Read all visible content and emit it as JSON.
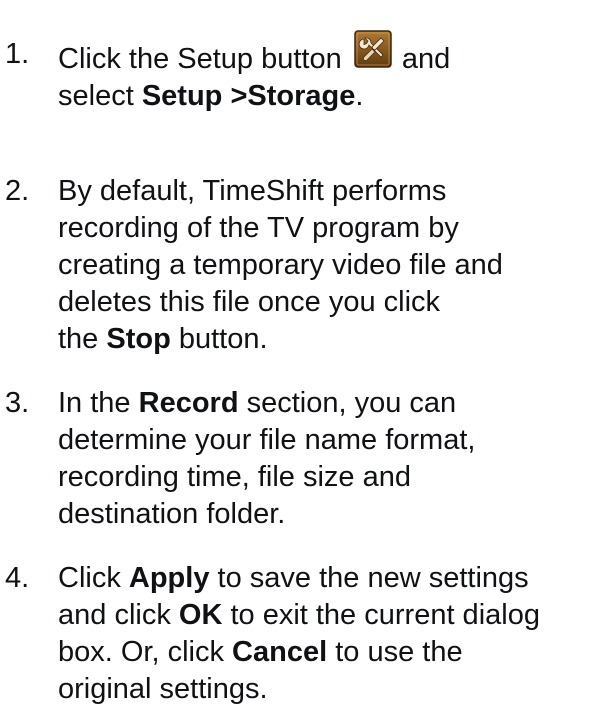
{
  "steps": [
    {
      "number": "1.",
      "line1_pre": "Click the Setup button",
      "line1_post": "and",
      "line2_pre": "select ",
      "line2_bold": "Setup >Storage",
      "line2_post": "."
    },
    {
      "number": "2.",
      "line1": "By default, TimeShift performs",
      "line2": "recording of the TV program by",
      "line3": "creating a temporary video file and",
      "line4": "deletes this file once you click",
      "line5_pre": "the ",
      "line5_bold": "Stop",
      "line5_post": " button."
    },
    {
      "number": "3.",
      "line1_pre": "In the ",
      "line1_bold": "Record",
      "line1_post": " section, you can",
      "line2": "determine your file name format,",
      "line3": "recording time, file size and",
      "line4": "destination folder."
    },
    {
      "number": "4.",
      "line1_pre": "Click ",
      "line1_bold": "Apply",
      "line1_post": " to save the new settings",
      "line2_pre": "and click ",
      "line2_bold": "OK",
      "line2_post": " to exit the current dialog",
      "line3_pre": "box. Or, click ",
      "line3_bold": "Cancel",
      "line3_post": " to use the",
      "line4": "original settings."
    }
  ],
  "icons": {
    "setup_icon": "wrench-screwdriver-icon",
    "setup_icon_bg": "#8a5a1c",
    "setup_icon_fg": "#f2e9d8"
  }
}
